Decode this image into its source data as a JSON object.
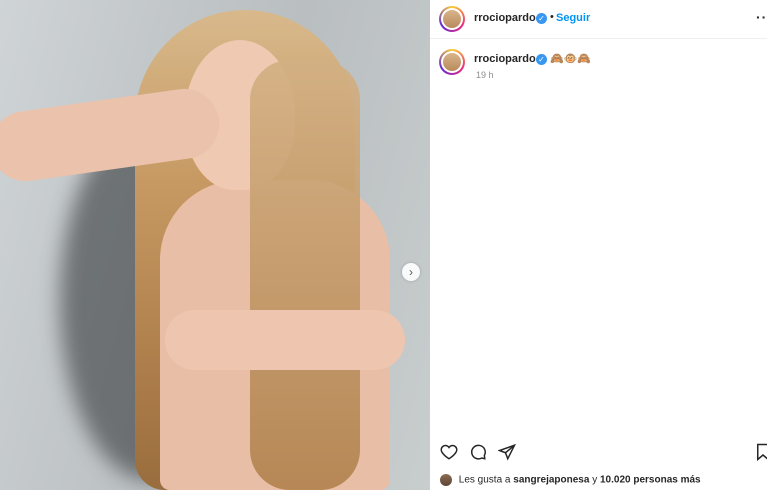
{
  "post": {
    "username": "rrociopardo",
    "follow_label": "Seguir",
    "separator": "•",
    "more_label": "··",
    "caption_emojis": "🙈🐵🙈",
    "time": "19 h",
    "likes_prefix": "Les gusta a",
    "likes_user": "sangrejaponesa",
    "likes_middle": "y",
    "likes_count": "10.020 personas más"
  },
  "icons": {
    "verified": "verified-badge-icon",
    "like": "heart-icon",
    "comment": "comment-icon",
    "share": "send-icon",
    "save": "bookmark-icon",
    "next": "chevron-right-icon"
  },
  "colors": {
    "accent": "#0095f6",
    "verified": "#3897f0",
    "text": "#262626",
    "muted": "#8e8e8e"
  }
}
